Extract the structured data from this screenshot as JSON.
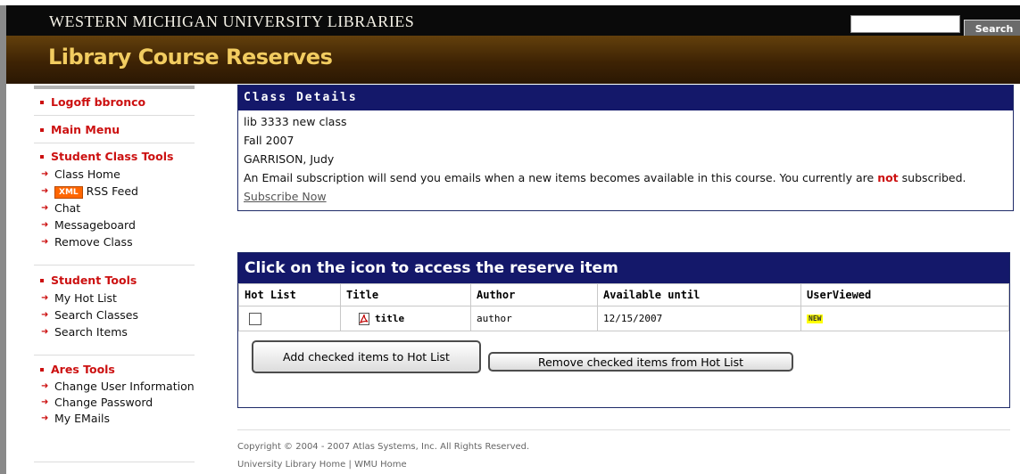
{
  "header": {
    "university": "WESTERN MICHIGAN UNIVERSITY LIBRARIES",
    "search_button": "Search",
    "search_value": "",
    "banner_title": "Library Course Reserves"
  },
  "sidebar": {
    "logoff": "Logoff bbronco",
    "main_menu": "Main Menu",
    "student_class_tools": {
      "title": "Student Class Tools",
      "items": [
        "Class Home",
        "RSS Feed",
        "Chat",
        "Messageboard",
        "Remove Class"
      ],
      "xml_badge": "XML"
    },
    "student_tools": {
      "title": "Student Tools",
      "items": [
        "My Hot List",
        "Search Classes",
        "Search Items"
      ]
    },
    "ares_tools": {
      "title": "Ares Tools",
      "items": [
        "Change User Information",
        "Change Password",
        "My EMails"
      ]
    }
  },
  "class_details": {
    "heading": "Class Details",
    "course": "lib 3333 new class",
    "term": "Fall 2007",
    "instructor": "GARRISON, Judy",
    "subscription_pre": "An Email subscription will send you emails when a new items becomes available in this course. You currently are ",
    "subscription_not": "not",
    "subscription_post": " subscribed.",
    "subscribe_link": "Subscribe Now"
  },
  "reserves": {
    "heading": "Click on the icon to access the reserve item",
    "columns": [
      "Hot List",
      "Title",
      "Author",
      "Available until",
      "UserViewed"
    ],
    "rows": [
      {
        "title": "title",
        "author": "author",
        "available": "12/15/2007",
        "viewed_badge": "NEW"
      }
    ],
    "add_button": "Add checked items to Hot List",
    "remove_button": "Remove checked items from Hot List"
  },
  "footer": {
    "copyright": "Copyright © 2004 - 2007 Atlas Systems, Inc. All Rights Reserved.",
    "library_home": "University Library Home",
    "separator": "|",
    "wmu_home": "WMU Home"
  },
  "colors": {
    "nav_red": "#cc1010",
    "panel_navy": "#14186a",
    "banner_brown": "#3e2304",
    "banner_gold": "#f2cc60"
  }
}
